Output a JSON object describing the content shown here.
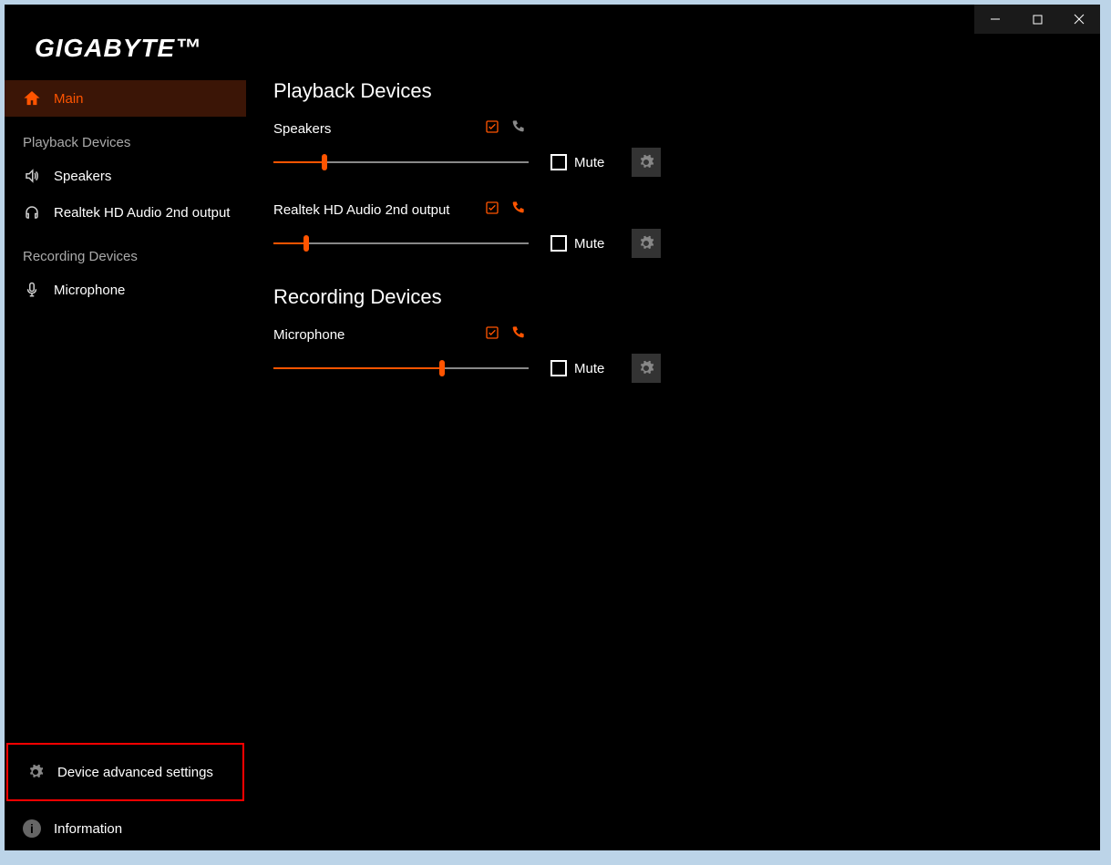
{
  "brand": "GIGABYTE™",
  "window_controls": {
    "minimize": "–",
    "maximize": "☐",
    "close": "✕"
  },
  "sidebar": {
    "main": "Main",
    "section_playback": "Playback Devices",
    "speakers": "Speakers",
    "realtek": "Realtek HD Audio 2nd output",
    "section_recording": "Recording Devices",
    "microphone": "Microphone",
    "advanced": "Device advanced settings",
    "information": "Information"
  },
  "content": {
    "playback_title": "Playback Devices",
    "recording_title": "Recording Devices",
    "devices": {
      "speakers": {
        "name": "Speakers",
        "level": 20,
        "mute_label": "Mute",
        "plugged": false
      },
      "realtek": {
        "name": "Realtek HD Audio 2nd output",
        "level": 13,
        "mute_label": "Mute",
        "plugged": true
      },
      "microphone": {
        "name": "Microphone",
        "level": 66,
        "mute_label": "Mute",
        "plugged": true
      }
    }
  },
  "colors": {
    "accent": "#ff5400",
    "highlight_border": "#ff0000"
  }
}
